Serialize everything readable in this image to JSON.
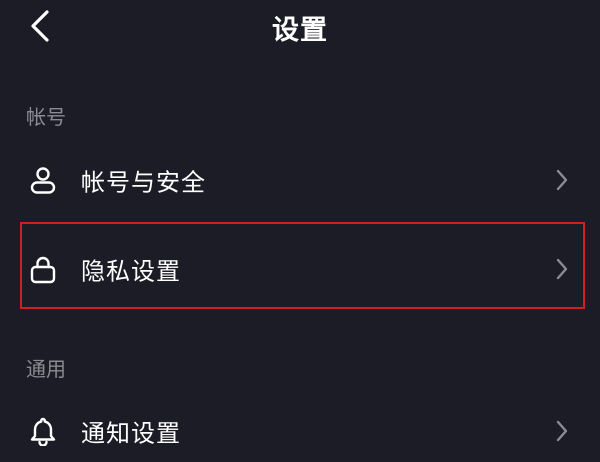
{
  "header": {
    "title": "设置",
    "back_icon": "chevron-left-icon"
  },
  "sections": {
    "account": {
      "title": "帐号",
      "items": [
        {
          "label": "帐号与安全",
          "icon": "user-icon"
        },
        {
          "label": "隐私设置",
          "icon": "lock-icon",
          "highlighted": true
        }
      ]
    },
    "general": {
      "title": "通用",
      "items": [
        {
          "label": "通知设置",
          "icon": "bell-icon"
        }
      ]
    }
  },
  "colors": {
    "background": "#1c1c26",
    "text": "#ffffff",
    "section_title": "#8b8b94",
    "chevron": "#8b8b94",
    "highlight": "#d11f1f"
  }
}
